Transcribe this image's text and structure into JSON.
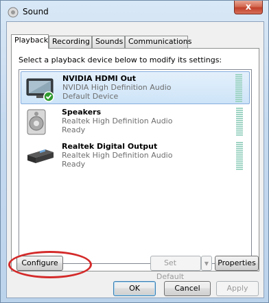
{
  "window": {
    "title": "Sound",
    "close_label": "x"
  },
  "tabs": [
    {
      "label": "Playback",
      "active": true
    },
    {
      "label": "Recording",
      "active": false
    },
    {
      "label": "Sounds",
      "active": false
    },
    {
      "label": "Communications",
      "active": false
    }
  ],
  "instruction": "Select a playback device below to modify its settings:",
  "devices": [
    {
      "name": "NVIDIA HDMI Out",
      "driver": "NVIDIA High Definition Audio",
      "status": "Default Device",
      "selected": true,
      "icon": "hdmi-monitor-icon",
      "default_check": true
    },
    {
      "name": "Speakers",
      "driver": "Realtek High Definition Audio",
      "status": "Ready",
      "selected": false,
      "icon": "speaker-icon"
    },
    {
      "name": "Realtek Digital Output",
      "driver": "Realtek High Definition Audio",
      "status": "Ready",
      "selected": false,
      "icon": "digital-output-icon"
    }
  ],
  "buttons": {
    "configure": "Configure",
    "set_default": "Set Default",
    "properties": "Properties",
    "ok": "OK",
    "cancel": "Cancel",
    "apply": "Apply"
  },
  "colors": {
    "highlight_oval": "#d42a2a",
    "selection": "#cde4f8",
    "level_meter": "#9fd4c4"
  }
}
